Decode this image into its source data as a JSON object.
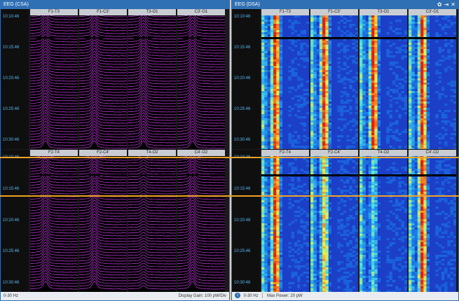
{
  "csa": {
    "title": "EEG (CSA)",
    "status_left": "0-30 Hz",
    "status_right": "Display Gain: 100 pW/Div",
    "top_channels": [
      "F1-T3",
      "F1-C3'",
      "T3-O1",
      "C3'-O1"
    ],
    "bottom_channels": [
      "F2-T4",
      "F2-C4'",
      "T4-O2",
      "C4'-O2"
    ],
    "times": [
      "10:10:46",
      "10:15:46",
      "10:20:46",
      "10:25:46",
      "10:30:46"
    ]
  },
  "dsa": {
    "title": "EEG (DSA)",
    "status_freq": "0-30 Hz",
    "status_power": "Max Power: 20 pW",
    "top_channels": [
      "F1-T3",
      "F1-C3'",
      "T3-O1",
      "C3'-O1"
    ],
    "bottom_channels": [
      "F2-T4",
      "F2-C4'",
      "T4-O2",
      "C4'-O2"
    ],
    "times": [
      "10:10:46",
      "10:15:46",
      "10:20:46",
      "10:25:46",
      "10:30:46"
    ]
  },
  "icons": {
    "settings": "gear-icon",
    "pin": "pin-icon",
    "close": "close-icon",
    "info": "info-icon"
  },
  "colors": {
    "csa_trace": "#e040ff",
    "marker": "#f0a325",
    "time_label": "#55b8f0",
    "titlebar": "#2f6fb3"
  }
}
